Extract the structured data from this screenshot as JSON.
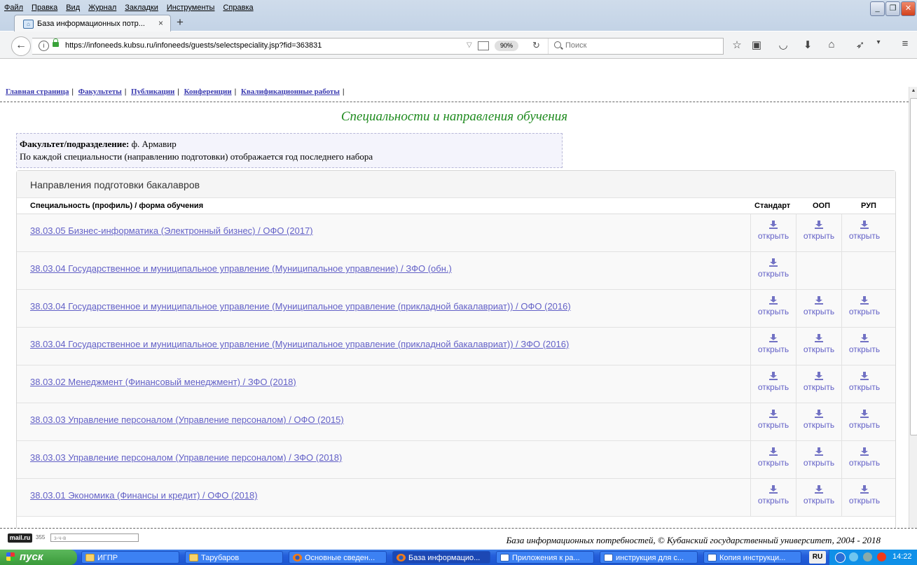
{
  "browser": {
    "menu": [
      "Файл",
      "Правка",
      "Вид",
      "Журнал",
      "Закладки",
      "Инструменты",
      "Справка"
    ],
    "tab_title": "База информационных потр...",
    "tab_close": "×",
    "new_tab": "+",
    "url": "https://infoneeds.kubsu.ru/infoneeds/guests/selectspeciality.jsp?fid=363831",
    "zoom": "90%",
    "search_placeholder": "Поиск"
  },
  "site": {
    "nav": [
      "Главная страница",
      "Факультеты",
      "Публикации",
      "Конференции",
      "Квалификационные работы"
    ],
    "title": "Специальности и направления обучения",
    "faculty_label": "Факультет/подразделение:",
    "faculty_value": "ф. Армавир",
    "faculty_note": "По каждой специальности (направлению подготовки) отображается год последнего набора",
    "panel_title": "Направления подготовки бакалавров",
    "columns": {
      "spec": "Специальность (профиль) / форма обучения",
      "standard": "Стандарт",
      "oop": "ООП",
      "rup": "РУП"
    },
    "open_label": "открыть",
    "rows": [
      {
        "label": "38.03.05 Бизнес-информатика (Электронный бизнес) / ОФО (2017)",
        "standard": true,
        "oop": true,
        "rup": true
      },
      {
        "label": "38.03.04 Государственное и муниципальное управление (Муниципальное управление) / ЗФО (обн.)",
        "standard": true,
        "oop": false,
        "rup": false
      },
      {
        "label": "38.03.04 Государственное и муниципальное управление (Муниципальное управление (прикладной бакалавриат)) / ОФО (2016)",
        "standard": true,
        "oop": true,
        "rup": true
      },
      {
        "label": "38.03.04 Государственное и муниципальное управление (Муниципальное управление (прикладной бакалавриат)) / ЗФО (2016)",
        "standard": true,
        "oop": true,
        "rup": true
      },
      {
        "label": "38.03.02 Менеджмент (Финансовый менеджмент) / ЗФО (2018)",
        "standard": true,
        "oop": true,
        "rup": true
      },
      {
        "label": "38.03.03 Управление персоналом (Управление персоналом) / ОФО (2015)",
        "standard": true,
        "oop": true,
        "rup": true
      },
      {
        "label": "38.03.03 Управление персоналом (Управление персоналом) / ЗФО (2018)",
        "standard": true,
        "oop": true,
        "rup": true
      },
      {
        "label": "38.03.01 Экономика (Финансы и кредит) / ОФО (2018)",
        "standard": true,
        "oop": true,
        "rup": true
      }
    ],
    "footer": "База информационных потребностей, © Кубанский государственный университет, 2004 - 2018"
  },
  "statusbar": {
    "mailru": "mail.ru",
    "mailru_count": "355",
    "mailru_search": "з-ч-в"
  },
  "taskbar": {
    "start": "пуск",
    "tasks": [
      {
        "label": "ИГПР",
        "icon": "folder",
        "active": false
      },
      {
        "label": "Тарубаров",
        "icon": "folder",
        "active": false
      },
      {
        "label": "Основные сведен...",
        "icon": "ff",
        "active": false
      },
      {
        "label": "База информацио...",
        "icon": "ff",
        "active": true
      },
      {
        "label": "Приложения к ра...",
        "icon": "doc",
        "active": false
      },
      {
        "label": "инструкция для с...",
        "icon": "doc",
        "active": false
      },
      {
        "label": "Копия инструкци...",
        "icon": "doc",
        "active": false
      }
    ],
    "lang": "RU",
    "clock": "14:22"
  }
}
